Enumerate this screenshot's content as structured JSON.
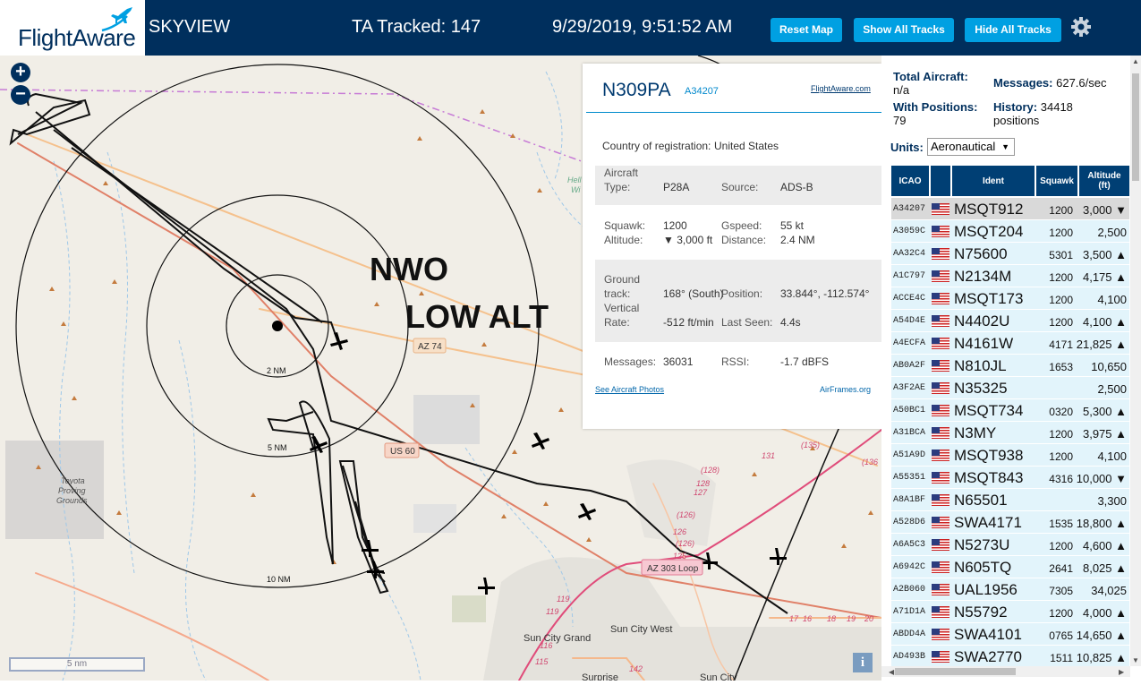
{
  "header": {
    "logo_text": "FlightAware",
    "app_name": "SKYVIEW",
    "tracked": "TA Tracked: 147",
    "datetime": "9/29/2019, 9:51:52 AM",
    "reset_label": "Reset Map",
    "show_label": "Show All Tracks",
    "hide_label": "Hide All Tracks"
  },
  "map": {
    "annotation_line1": "NWO",
    "annotation_line2": "LOW ALT",
    "ring_labels": [
      "2 NM",
      "5 NM",
      "10 NM"
    ],
    "road_labels": [
      "AZ 74",
      "US 60",
      "AZ 303 Loop"
    ],
    "place_labels": [
      "Sun City Grand",
      "Sun City West",
      "Toyota",
      "Proving",
      "Grounds",
      "Surprise",
      "Sun City",
      "Hell",
      "Wi"
    ],
    "route_labels": [
      "(135)",
      "131",
      "(136",
      "(128)",
      "128",
      "127",
      "(126)",
      "126",
      "(126)",
      "125",
      "119",
      "119",
      "116",
      "115",
      "142",
      "17",
      "16",
      "18",
      "19",
      "20"
    ],
    "scale_label": "5 nm",
    "zoom_in": "+",
    "zoom_out": "−",
    "info_label": "i"
  },
  "popup": {
    "registration": "N309PA",
    "hex": "A34207",
    "fa_link": "FlightAware.com",
    "country_label": "Country of registration:",
    "country": "United States",
    "aircraft_type_label": "Aircraft Type:",
    "aircraft_type": "P28A",
    "source_label": "Source:",
    "source": "ADS-B",
    "squawk_label": "Squawk:",
    "squawk": "1200",
    "gspeed_label": "Gspeed:",
    "gspeed": "55 kt",
    "altitude_label": "Altitude:",
    "altitude": "▼ 3,000 ft",
    "distance_label": "Distance:",
    "distance": "2.4 NM",
    "ground_track_label": "Ground track:",
    "ground_track": "168° (South)",
    "position_label": "Position:",
    "position": "33.844°, -112.574°",
    "vrate_label": "Vertical Rate:",
    "vrate": "-512 ft/min",
    "last_seen_label": "Last Seen:",
    "last_seen": "4.4s",
    "messages_label": "Messages:",
    "messages": "36031",
    "rssi_label": "RSSI:",
    "rssi": "-1.7 dBFS",
    "photos_link": "See Aircraft Photos",
    "airframes_link": "AirFrames.org"
  },
  "stats": {
    "total_label": "Total Aircraft:",
    "total_value": "n/a",
    "messages_label": "Messages:",
    "messages_value": "627.6/sec",
    "with_pos_label": "With Positions:",
    "with_pos_value": "79",
    "history_label": "History:",
    "history_value": "34418",
    "history_unit": "positions",
    "units_label": "Units:",
    "units_value": "Aeronautical"
  },
  "table": {
    "headers": {
      "icao": "ICAO",
      "ident": "Ident",
      "squawk": "Squawk",
      "alt1": "Altitude",
      "alt2": "(ft)"
    },
    "rows": [
      {
        "icao": "A34207",
        "ident": "MSQT912",
        "squawk": "1200",
        "alt": "3,000 ▼"
      },
      {
        "icao": "A3059C",
        "ident": "MSQT204",
        "squawk": "1200",
        "alt": "2,500"
      },
      {
        "icao": "AA32C4",
        "ident": "N75600",
        "squawk": "5301",
        "alt": "3,500 ▲"
      },
      {
        "icao": "A1C797",
        "ident": "N2134M",
        "squawk": "1200",
        "alt": "4,175 ▲"
      },
      {
        "icao": "ACCE4C",
        "ident": "MSQT173",
        "squawk": "1200",
        "alt": "4,100"
      },
      {
        "icao": "A54D4E",
        "ident": "N4402U",
        "squawk": "1200",
        "alt": "4,100 ▲"
      },
      {
        "icao": "A4ECFA",
        "ident": "N4161W",
        "squawk": "4171",
        "alt": "21,825 ▲"
      },
      {
        "icao": "AB0A2F",
        "ident": "N810JL",
        "squawk": "1653",
        "alt": "10,650"
      },
      {
        "icao": "A3F2AE",
        "ident": "N35325",
        "squawk": "",
        "alt": "2,500"
      },
      {
        "icao": "A50BC1",
        "ident": "MSQT734",
        "squawk": "0320",
        "alt": "5,300 ▲"
      },
      {
        "icao": "A31BCA",
        "ident": "N3MY",
        "squawk": "1200",
        "alt": "3,975 ▲"
      },
      {
        "icao": "A51A9D",
        "ident": "MSQT938",
        "squawk": "1200",
        "alt": "4,100"
      },
      {
        "icao": "A55351",
        "ident": "MSQT843",
        "squawk": "4316",
        "alt": "10,000 ▼"
      },
      {
        "icao": "A8A1BF",
        "ident": "N65501",
        "squawk": "",
        "alt": "3,300"
      },
      {
        "icao": "A528D6",
        "ident": "SWA4171",
        "squawk": "1535",
        "alt": "18,800 ▲"
      },
      {
        "icao": "A6A5C3",
        "ident": "N5273U",
        "squawk": "1200",
        "alt": "4,600 ▲"
      },
      {
        "icao": "A6942C",
        "ident": "N605TQ",
        "squawk": "2641",
        "alt": "8,025 ▲"
      },
      {
        "icao": "A2B060",
        "ident": "UAL1956",
        "squawk": "7305",
        "alt": "34,025"
      },
      {
        "icao": "A71D1A",
        "ident": "N55792",
        "squawk": "1200",
        "alt": "4,000 ▲"
      },
      {
        "icao": "ABDD4A",
        "ident": "SWA4101",
        "squawk": "0765",
        "alt": "14,650 ▲"
      },
      {
        "icao": "AD493B",
        "ident": "SWA2770",
        "squawk": "1511",
        "alt": "10,825 ▲"
      }
    ]
  },
  "colors": {
    "header": "#002f5d",
    "button": "#00a0e2",
    "row": "#e2f4fb",
    "table_header": "#003f74"
  }
}
